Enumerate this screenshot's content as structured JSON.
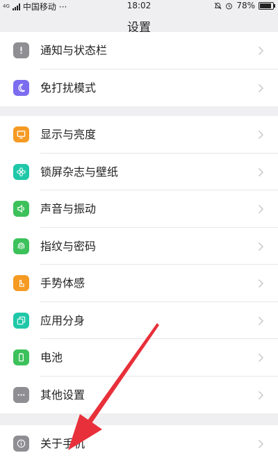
{
  "status_bar": {
    "network_type": "4G",
    "carrier": "中国移动",
    "more": "···",
    "time": "18:02",
    "battery_percent": "78%",
    "battery_level": 0.78
  },
  "header": {
    "title": "设置"
  },
  "groups": [
    {
      "items": [
        {
          "label": "通知与状态栏",
          "icon": "notification-icon",
          "color": "#8e8e93"
        },
        {
          "label": "免打扰模式",
          "icon": "moon-icon",
          "color": "#7b6cf0"
        }
      ]
    },
    {
      "items": [
        {
          "label": "显示与亮度",
          "icon": "display-icon",
          "color": "#f59a23"
        },
        {
          "label": "锁屏杂志与壁纸",
          "icon": "flower-icon",
          "color": "#1fc8a8"
        },
        {
          "label": "声音与振动",
          "icon": "speaker-icon",
          "color": "#3cc15b"
        },
        {
          "label": "指纹与密码",
          "icon": "fingerprint-icon",
          "color": "#3cc15b"
        },
        {
          "label": "手势体感",
          "icon": "gesture-icon",
          "color": "#f59a23"
        },
        {
          "label": "应用分身",
          "icon": "clone-icon",
          "color": "#1fc8a8"
        },
        {
          "label": "电池",
          "icon": "battery-icon",
          "color": "#3cc15b"
        },
        {
          "label": "其他设置",
          "icon": "more-icon",
          "color": "#8e8e93"
        }
      ]
    },
    {
      "items": [
        {
          "label": "关于手机",
          "icon": "info-icon",
          "color": "#8e8e93"
        }
      ]
    }
  ],
  "annotation": {
    "arrow_color": "#e8303a"
  }
}
